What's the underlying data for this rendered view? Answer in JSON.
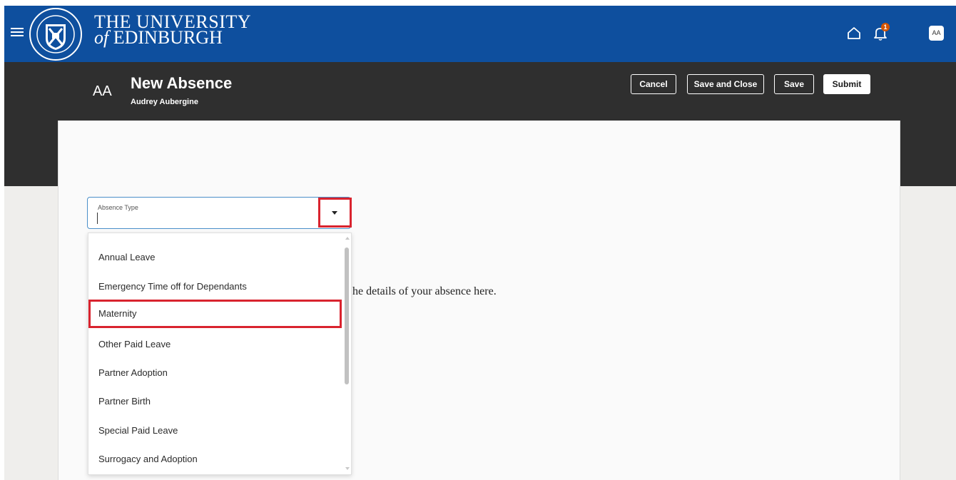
{
  "header": {
    "university_line1": "THE UNIVERSITY",
    "university_of": "of",
    "university_line2": "EDINBURGH",
    "notification_count": "1",
    "user_initials_badge": "AA"
  },
  "page": {
    "initials": "AA",
    "title": "New Absence",
    "person_name": "Audrey Aubergine"
  },
  "toolbar": {
    "cancel_label": "Cancel",
    "save_close_label": "Save and Close",
    "save_label": "Save",
    "submit_label": "Submit"
  },
  "form": {
    "absence_type_label": "Absence Type",
    "absence_type_value": "",
    "helper_text": "he details of your absence here."
  },
  "dropdown": {
    "options": [
      "Annual Leave",
      "Emergency Time off for Dependants",
      "Maternity",
      "Other Paid Leave",
      "Partner Adoption",
      "Partner Birth",
      "Special Paid Leave",
      "Surrogacy and Adoption"
    ],
    "highlighted": "Maternity"
  },
  "colors": {
    "brand_blue": "#0e4f9e",
    "header_dark": "#2f2f2f",
    "highlight_red": "#d9232e",
    "badge_orange": "#d35400"
  },
  "icons": {
    "menu": "hamburger-menu-icon",
    "crest": "university-crest-icon",
    "home": "home-icon",
    "notifications": "bell-icon",
    "dropdown": "caret-down-icon"
  }
}
